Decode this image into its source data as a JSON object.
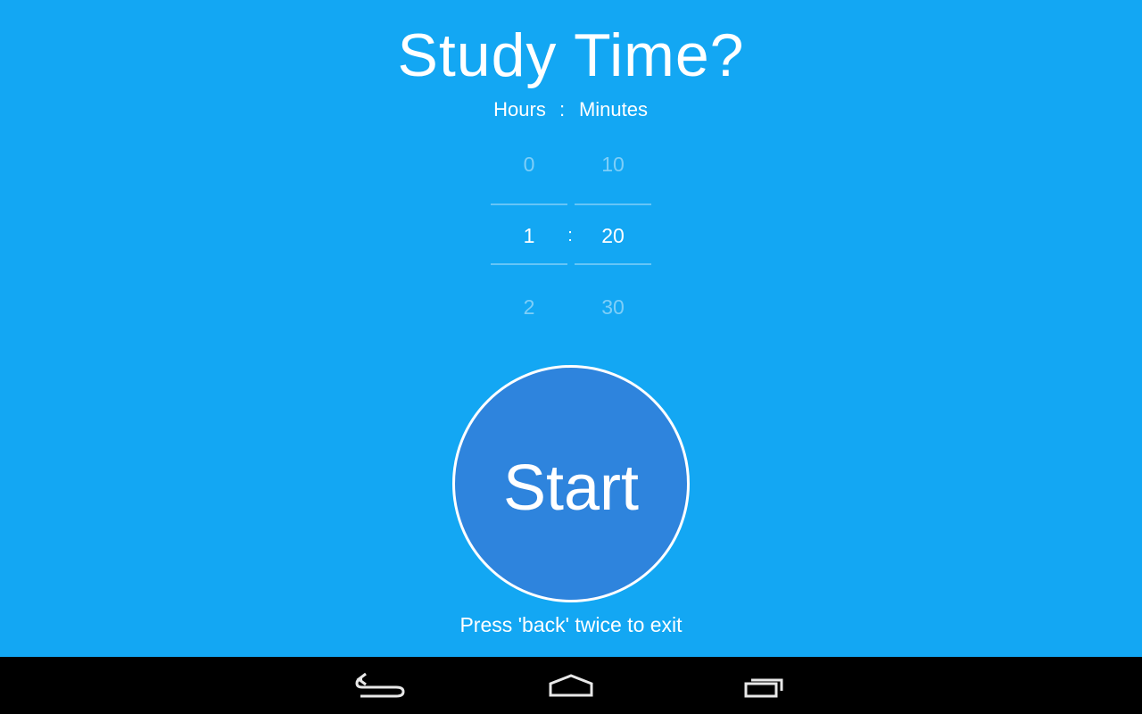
{
  "app": {
    "title": "Study Time?",
    "headers": {
      "hours": "Hours",
      "separator": ":",
      "minutes": "Minutes"
    },
    "hours_picker": {
      "prev": "0",
      "current": "1",
      "next": "2"
    },
    "picker_separator": ":",
    "minutes_picker": {
      "prev": "10",
      "current": "20",
      "next": "30"
    },
    "start_label": "Start",
    "hint": "Press 'back' twice to exit"
  },
  "colors": {
    "background": "#13a7f3",
    "button": "#2e84dd",
    "navbar": "#000000"
  },
  "navbar": {
    "icons": [
      "back-icon",
      "home-icon",
      "recent-apps-icon"
    ]
  }
}
